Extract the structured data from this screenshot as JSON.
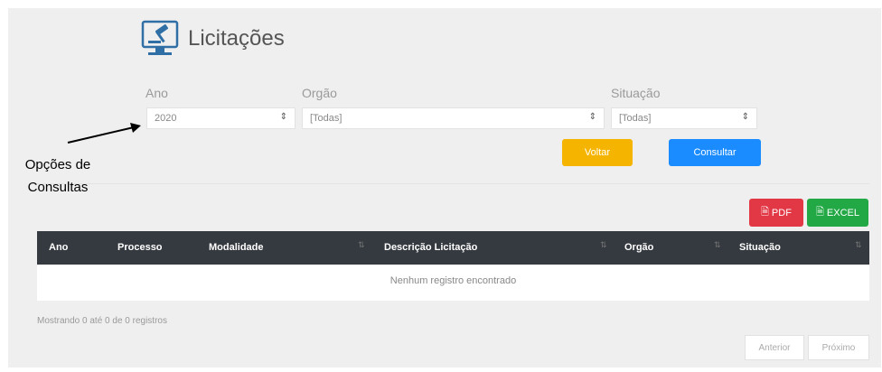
{
  "header": {
    "title": "Licitações",
    "icon": "gavel-monitor-icon"
  },
  "filters": {
    "ano": {
      "label": "Ano",
      "value": "2020"
    },
    "orgao": {
      "label": "Orgão",
      "value": "[Todas]"
    },
    "situacao": {
      "label": "Situação",
      "value": "[Todas]"
    }
  },
  "actions": {
    "voltar": "Voltar",
    "consultar": "Consultar"
  },
  "export": {
    "pdf": "PDF",
    "excel": "EXCEL"
  },
  "table": {
    "columns": [
      "Ano",
      "Processo",
      "Modalidade",
      "Descrição Licitação",
      "Orgão",
      "Situação"
    ],
    "empty_message": "Nenhum registro encontrado"
  },
  "footer": {
    "info": "Mostrando 0 até 0 de 0 registros",
    "prev": "Anterior",
    "next": "Próximo"
  },
  "annotation": {
    "line1": "Opções de",
    "line2": "Consultas"
  },
  "colors": {
    "voltar": "#f5b400",
    "consultar": "#1a8cff",
    "pdf": "#e23744",
    "excel": "#22a845",
    "table_header": "#353a40"
  }
}
